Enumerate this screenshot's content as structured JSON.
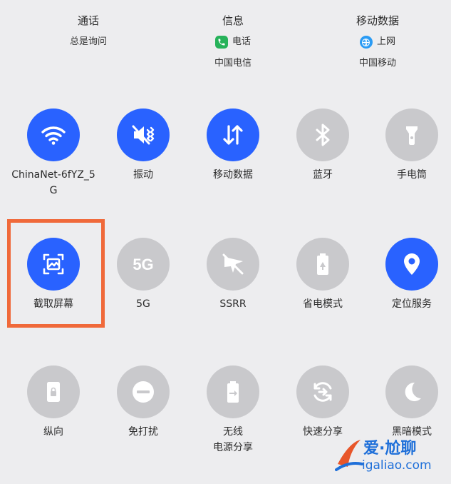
{
  "sim": {
    "calls": {
      "title": "通话",
      "value": "总是询问"
    },
    "sms": {
      "title": "信息",
      "value": "电话",
      "carrier": "中国电信"
    },
    "data": {
      "title": "移动数据",
      "value": "上网",
      "carrier": "中国移动"
    }
  },
  "tiles": {
    "row1": [
      {
        "label": "ChinaNet-6fYZ_5G",
        "state": "on",
        "icon": "wifi-icon"
      },
      {
        "label": "振动",
        "state": "on",
        "icon": "vibrate-icon"
      },
      {
        "label": "移动数据",
        "state": "on",
        "icon": "mobile-data-icon"
      },
      {
        "label": "蓝牙",
        "state": "off",
        "icon": "bluetooth-icon"
      },
      {
        "label": "手电筒",
        "state": "off",
        "icon": "flashlight-icon"
      }
    ],
    "row2": [
      {
        "label": "截取屏幕",
        "state": "on",
        "icon": "screenshot-icon"
      },
      {
        "label": "5G",
        "state": "off",
        "icon": "5g-icon"
      },
      {
        "label": "SSRR",
        "state": "off",
        "icon": "ssrr-icon"
      },
      {
        "label": "省电模式",
        "state": "off",
        "icon": "battery-saver-icon"
      },
      {
        "label": "定位服务",
        "state": "on",
        "icon": "location-icon"
      }
    ],
    "row3": [
      {
        "label": "纵向",
        "state": "off",
        "icon": "portrait-lock-icon"
      },
      {
        "label": "免打扰",
        "state": "off",
        "icon": "do-not-disturb-icon"
      },
      {
        "label": "无线\n电源分享",
        "state": "off",
        "icon": "wireless-power-share-icon"
      },
      {
        "label": "快速分享",
        "state": "off",
        "icon": "quick-share-icon"
      },
      {
        "label": "黑暗模式",
        "state": "off",
        "icon": "dark-mode-icon"
      }
    ]
  },
  "watermark": {
    "line1": "爱·尬聊",
    "line2": "igaliao.com"
  },
  "colors": {
    "active": "#2962ff",
    "inactive": "#c9c9cc",
    "highlight": "#f0693a"
  }
}
